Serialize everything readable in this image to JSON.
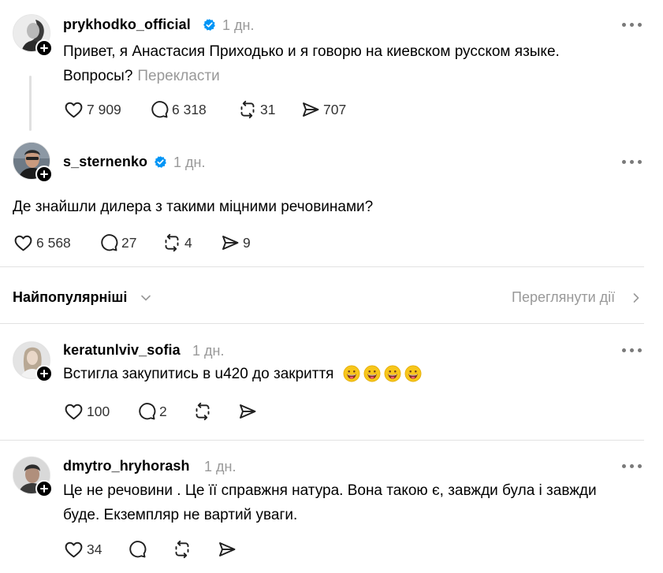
{
  "posts": [
    {
      "username": "prykhodko_official",
      "verified": true,
      "time": "1 дн.",
      "text": "Привет, я Анастасия Приходько и я говорю на киевском русском языке. Вопросы?",
      "translate_label": "Перекласти",
      "likes": "7 909",
      "replies": "6 318",
      "reposts": "31",
      "shares": "707"
    },
    {
      "username": "s_sternenko",
      "verified": true,
      "time": "1 дн.",
      "text": "Де знайшли дилера з такими міцними речовинами?",
      "likes": "6 568",
      "replies": "27",
      "reposts": "4",
      "shares": "9"
    }
  ],
  "sort_bar": {
    "label": "Найпопулярніші",
    "activity_link": "Переглянути дії"
  },
  "comments": [
    {
      "username": "keratunlviv_sofia",
      "time": "1 дн.",
      "text": "Встигла закупитись в u420 до закриття",
      "emoji_count": 4,
      "likes": "100",
      "replies": "2"
    },
    {
      "username": "dmytro_hryhorash",
      "time": "1 дн.",
      "text_line1": "Це не речовини . Це її справжня натура. Вона такою є, завжди була і завжди",
      "text_line2": "буде. Екземпляр не вартий уваги.",
      "likes": "34"
    }
  ],
  "colors": {
    "verified": "#0095f6",
    "muted": "#999999",
    "divider": "#e2e2e2",
    "thread_line": "#e0e0e0"
  },
  "icons": [
    "heart-icon",
    "comment-icon",
    "repost-icon",
    "share-icon",
    "more-icon",
    "verified-badge-icon",
    "follow-plus-icon",
    "chevron-down-icon",
    "chevron-right-icon",
    "grinning-emoji-icon"
  ]
}
